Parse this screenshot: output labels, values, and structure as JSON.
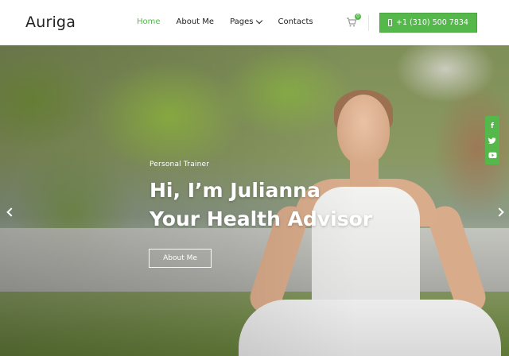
{
  "brand": {
    "logo": "Auriga"
  },
  "nav": {
    "items": [
      {
        "label": "Home",
        "active": true
      },
      {
        "label": "About Me",
        "active": false
      },
      {
        "label": "Pages",
        "active": false,
        "has_dropdown": true
      },
      {
        "label": "Contacts",
        "active": false
      }
    ]
  },
  "header": {
    "cart_count": "0",
    "phone": "+1 (310) 500 7834",
    "accent_color": "#54b84b"
  },
  "hero": {
    "subtitle": "Personal Trainer",
    "heading_line1": "Hi, I’m Julianna",
    "heading_line2": "Your Health Advisor",
    "button_label": "About Me"
  },
  "social": {
    "items": [
      {
        "name": "facebook-icon",
        "glyph": "f"
      },
      {
        "name": "twitter-icon",
        "glyph": "t"
      },
      {
        "name": "youtube-icon",
        "glyph": "▶"
      }
    ]
  }
}
